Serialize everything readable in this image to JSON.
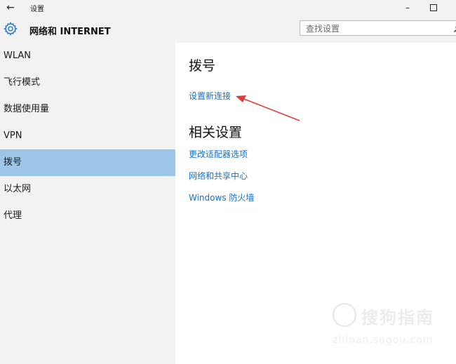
{
  "titlebar": {
    "back_icon": "←",
    "title": "设置",
    "minimize_icon": "–"
  },
  "header": {
    "icon": "gear-icon",
    "title": "网络和 INTERNET"
  },
  "search": {
    "placeholder": "查找设置",
    "icon": "search-icon"
  },
  "sidebar": {
    "items": [
      {
        "label": "WLAN"
      },
      {
        "label": "飞行模式"
      },
      {
        "label": "数据使用量"
      },
      {
        "label": "VPN"
      },
      {
        "label": "拨号",
        "selected": true
      },
      {
        "label": "以太网"
      },
      {
        "label": "代理"
      }
    ]
  },
  "main": {
    "section1_title": "拨号",
    "new_connection_link": "设置新连接",
    "section2_title": "相关设置",
    "links": [
      "更改适配器选项",
      "网络和共享中心",
      "Windows 防火墙"
    ]
  },
  "annotation": {
    "arrow_color": "#e03a3a"
  },
  "watermark": {
    "text": "搜狗指南",
    "url": "zhinan.sogou.com"
  },
  "colors": {
    "accent_link": "#1670c8",
    "selected_bg": "#9dc5e7",
    "sidebar_bg": "#f2f2f2"
  }
}
